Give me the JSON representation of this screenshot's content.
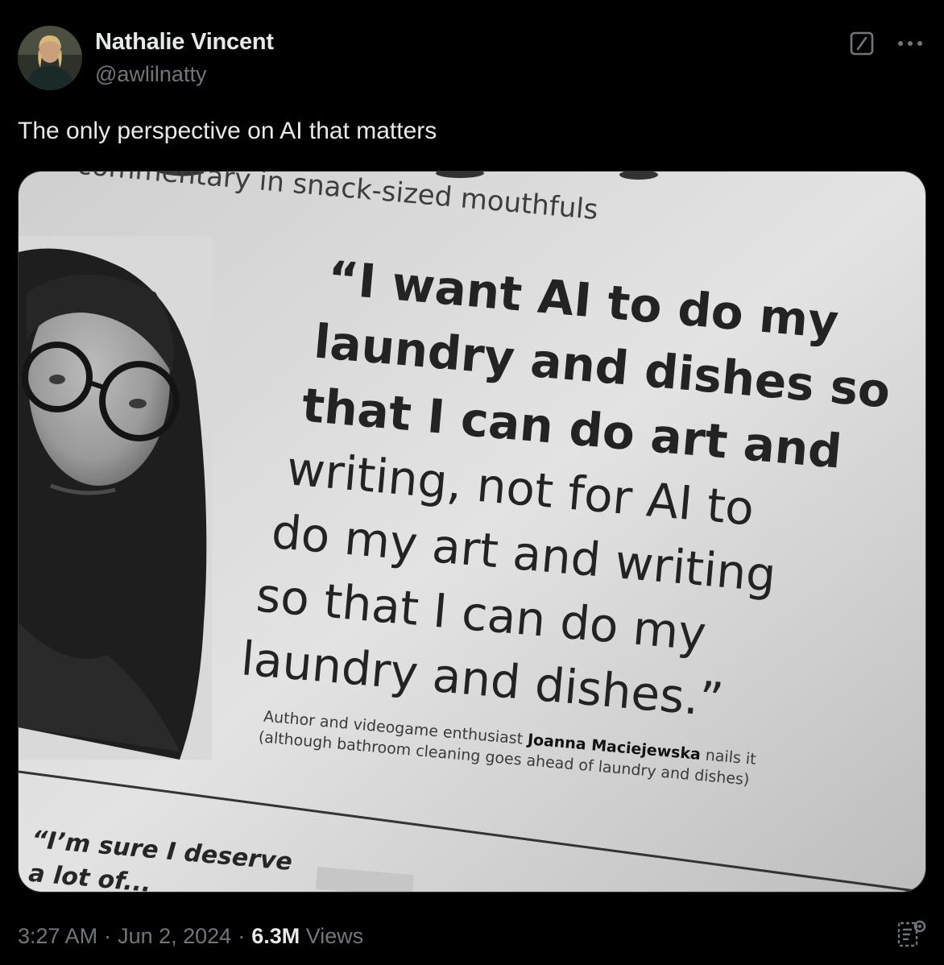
{
  "author": {
    "display_name": "Nathalie Vincent",
    "handle": "@awlilnatty",
    "avatar_icon": "user-avatar"
  },
  "tweet": {
    "text": "The only perspective on AI that matters"
  },
  "media": {
    "kind": "photo of magazine page",
    "heading_text": "commentary in snack-sized mouthfuls",
    "quote_lines": [
      "“I want AI to do my",
      "laundry and dishes so",
      "that I can do art and",
      "writing, not for AI to",
      "do my art and writing",
      "so that I can do my",
      "laundry and dishes.”"
    ],
    "caption_line_1_prefix": "Author and videogame enthusiast ",
    "caption_name": "Joanna Maciejewska",
    "caption_line_1_suffix": " nails it",
    "caption_line_2": "(although bathroom cleaning goes ahead of laundry and dishes)",
    "next_quote": "“I’m sure I deserve",
    "next_quote_2": "a lot of..."
  },
  "meta": {
    "time": "3:27 AM",
    "separator": "·",
    "date": "Jun 2, 2024",
    "views_count": "6.3M",
    "views_label": "Views"
  },
  "icons": {
    "grok": "grok-icon",
    "more": "more-icon",
    "analytics": "analytics-icon"
  },
  "colors": {
    "background": "#000000",
    "primary_text": "#e7e9ea",
    "secondary_text": "#71767b",
    "border": "#2f3336"
  }
}
